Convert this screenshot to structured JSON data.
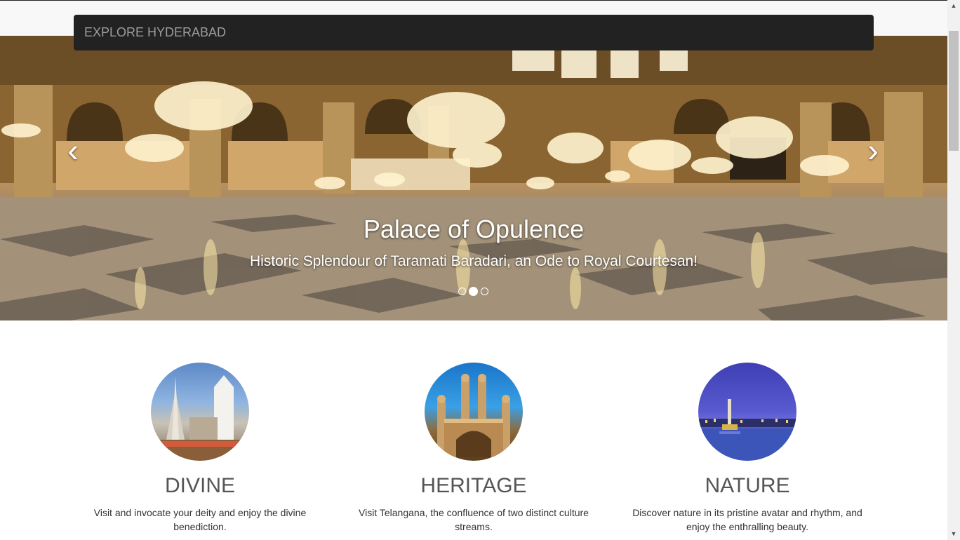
{
  "navbar": {
    "brand": "EXPLORE HYDERABAD"
  },
  "carousel": {
    "slide_title": "Palace of Opulence",
    "slide_subtitle": "Historic Splendour of Taramati Baradari, an Ode to Royal Courtesan!",
    "prev_icon": "chevron-left-icon",
    "next_icon": "chevron-right-icon",
    "indicator_count": 3,
    "active_indicator": 2
  },
  "features": [
    {
      "title": "DIVINE",
      "text": "Visit and invocate your deity and enjoy the divine benediction.",
      "image": "temple-image"
    },
    {
      "title": "HERITAGE",
      "text": "Visit Telangana, the confluence of two distinct culture streams.",
      "image": "charminar-image"
    },
    {
      "title": "NATURE",
      "text": "Discover nature in its pristine avatar and rhythm, and enjoy the enthralling beauty.",
      "image": "lake-image"
    }
  ],
  "colors": {
    "navbar_bg": "#222222",
    "brand_text": "#9d9d9d",
    "heading": "#555555"
  }
}
